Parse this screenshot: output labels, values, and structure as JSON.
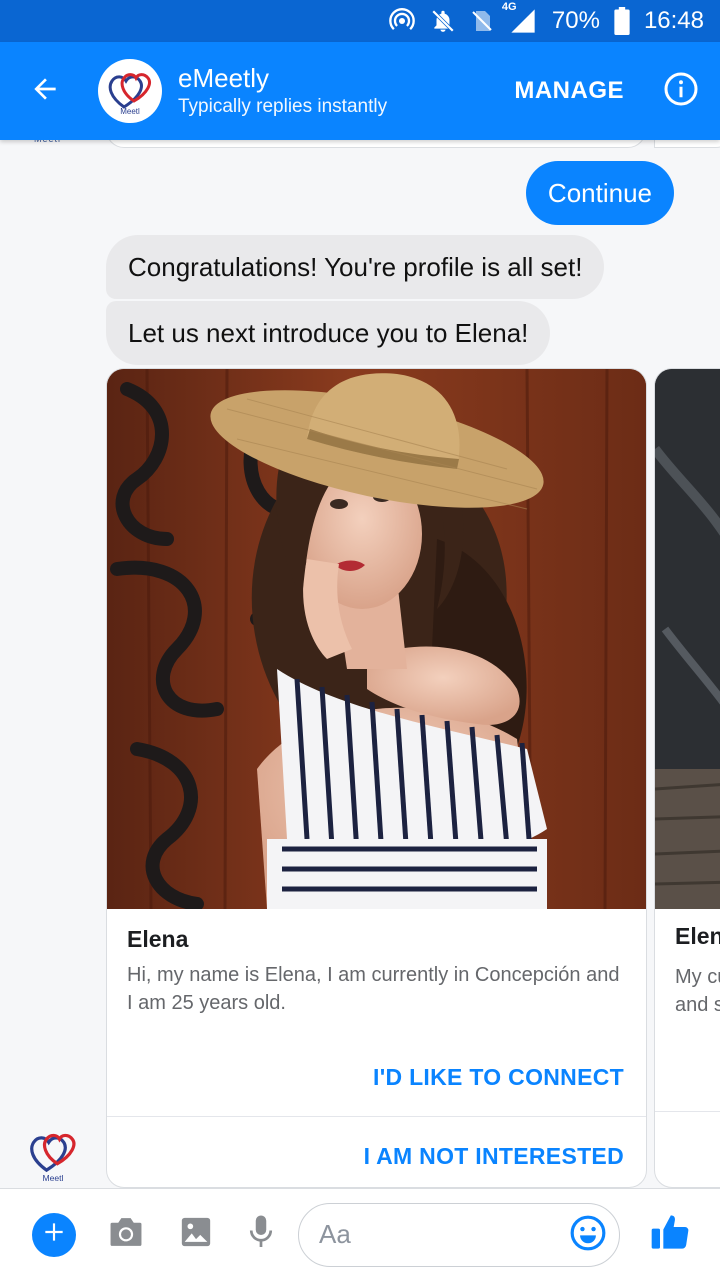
{
  "status_bar": {
    "network": "4G",
    "battery": "70%",
    "time": "16:48"
  },
  "header": {
    "title": "eMeetly",
    "subtitle": "Typically replies instantly",
    "manage_label": "MANAGE",
    "avatar_text": "Meetl"
  },
  "messages": {
    "outgoing": "Continue",
    "incoming_1": "Congratulations! You're profile is all set!",
    "incoming_2": "Let us next introduce you to Elena!"
  },
  "card": {
    "title": "Elena",
    "description": "Hi, my name is Elena, I am currently in Concepción and I am 25 years old.",
    "action_connect": "I'D LIKE TO CONNECT",
    "action_not_interested": "I AM NOT INTERESTED"
  },
  "card_peek": {
    "title": "Elena",
    "description": "My current city is ... and s"
  },
  "composer": {
    "placeholder": "Aa"
  },
  "colors": {
    "messenger_blue": "#0a84ff",
    "status_bar": "#0a66d2",
    "incoming_bubble": "#e9e9eb"
  }
}
